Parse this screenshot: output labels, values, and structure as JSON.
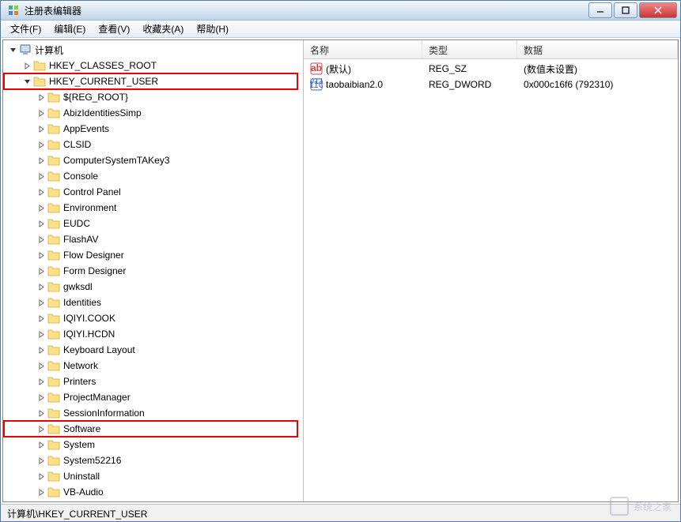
{
  "window": {
    "title": "注册表编辑器"
  },
  "menu": {
    "file": "文件(F)",
    "edit": "编辑(E)",
    "view": "查看(V)",
    "fav": "收藏夹(A)",
    "help": "帮助(H)"
  },
  "tree": {
    "root": "计算机",
    "classes_root": "HKEY_CLASSES_ROOT",
    "current_user": "HKEY_CURRENT_USER",
    "children": [
      "${REG_ROOT}",
      "AbizIdentitiesSimp",
      "AppEvents",
      "CLSID",
      "ComputerSystemTAKey3",
      "Console",
      "Control Panel",
      "Environment",
      "EUDC",
      "FlashAV",
      "Flow Designer",
      "Form Designer",
      "gwksdl",
      "Identities",
      "IQIYI.COOK",
      "IQIYI.HCDN",
      "Keyboard Layout",
      "Network",
      "Printers",
      "ProjectManager",
      "SessionInformation",
      "Software",
      "System",
      "System52216",
      "Uninstall",
      "VB-Audio"
    ],
    "highlight_indices": [
      21
    ],
    "highlight_parent": true
  },
  "list": {
    "columns": {
      "name": "名称",
      "type": "类型",
      "data": "数据"
    },
    "rows": [
      {
        "icon": "ab",
        "name": "(默认)",
        "type": "REG_SZ",
        "data": "(数值未设置)"
      },
      {
        "icon": "bin",
        "name": "taobaibian2.0",
        "type": "REG_DWORD",
        "data": "0x000c16f6 (792310)"
      }
    ]
  },
  "statusbar": {
    "path": "计算机\\HKEY_CURRENT_USER"
  },
  "watermark": "系统之家"
}
